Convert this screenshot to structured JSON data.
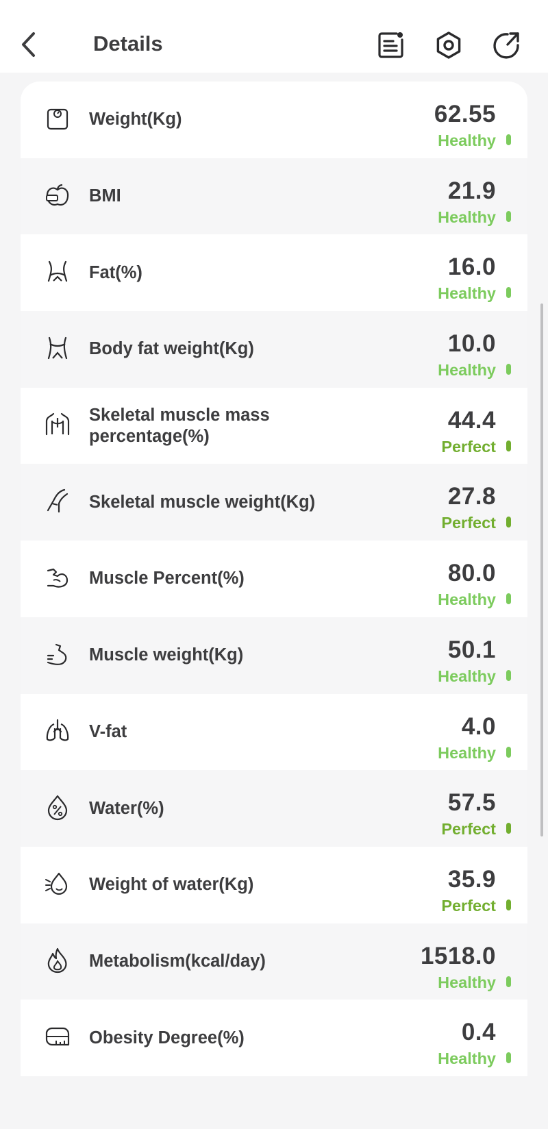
{
  "header": {
    "title": "Details"
  },
  "accent_colors": {
    "healthy": "#7ccb5d",
    "perfect": "#72ae2f"
  },
  "metrics": [
    {
      "icon": "scale-icon",
      "label": "Weight(Kg)",
      "value": "62.55",
      "status": "Healthy",
      "level": "healthy"
    },
    {
      "icon": "apple-icon",
      "label": "BMI",
      "value": "21.9",
      "status": "Healthy",
      "level": "healthy"
    },
    {
      "icon": "waist-icon",
      "label": "Fat(%)",
      "value": "16.0",
      "status": "Healthy",
      "level": "healthy"
    },
    {
      "icon": "hips-icon",
      "label": "Body fat weight(Kg)",
      "value": "10.0",
      "status": "Healthy",
      "level": "healthy"
    },
    {
      "icon": "torso-icon",
      "label": "Skeletal muscle mass percentage(%)",
      "value": "44.4",
      "status": "Perfect",
      "level": "perfect"
    },
    {
      "icon": "leg-icon",
      "label": "Skeletal muscle weight(Kg)",
      "value": "27.8",
      "status": "Perfect",
      "level": "perfect"
    },
    {
      "icon": "arm-flex-icon",
      "label": "Muscle Percent(%)",
      "value": "80.0",
      "status": "Healthy",
      "level": "healthy"
    },
    {
      "icon": "bicep-icon",
      "label": "Muscle weight(Kg)",
      "value": "50.1",
      "status": "Healthy",
      "level": "healthy"
    },
    {
      "icon": "lungs-icon",
      "label": "V-fat",
      "value": "4.0",
      "status": "Healthy",
      "level": "healthy"
    },
    {
      "icon": "water-percent-icon",
      "label": "Water(%)",
      "value": "57.5",
      "status": "Perfect",
      "level": "perfect"
    },
    {
      "icon": "water-drop-icon",
      "label": "Weight of water(Kg)",
      "value": "35.9",
      "status": "Perfect",
      "level": "perfect"
    },
    {
      "icon": "flame-icon",
      "label": "Metabolism(kcal/day)",
      "value": "1518.0",
      "status": "Healthy",
      "level": "healthy"
    },
    {
      "icon": "tape-measure-icon",
      "label": "Obesity Degree(%)",
      "value": "0.4",
      "status": "Healthy",
      "level": "healthy"
    }
  ]
}
